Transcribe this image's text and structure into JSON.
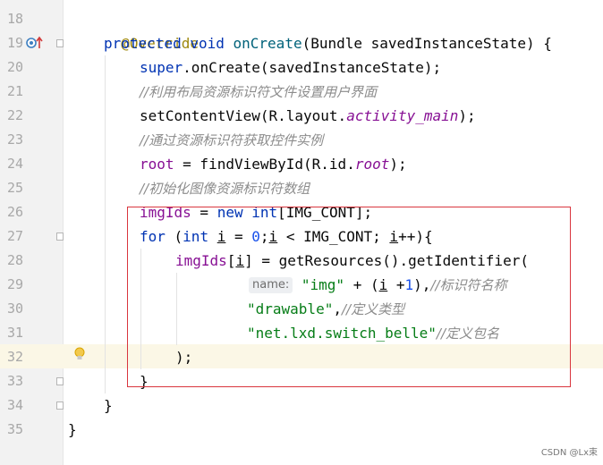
{
  "line_numbers": [
    "18",
    "19",
    "20",
    "21",
    "22",
    "23",
    "24",
    "25",
    "26",
    "27",
    "28",
    "29",
    "30",
    "31",
    "32",
    "33",
    "34",
    "35"
  ],
  "code": {
    "l18": "@Override",
    "l19": [
      "protected",
      "void",
      "onCreate",
      "(Bundle savedInstanceState) {"
    ],
    "l20": [
      "super",
      ".onCreate(savedInstanceState);"
    ],
    "l21": "//利用布局资源标识符文件设置用户界面",
    "l22": [
      "setContentView(R.layout.",
      "activity_main",
      ");"
    ],
    "l23": "//通过资源标识符获取控件实例",
    "l24": [
      "root",
      " = findViewById(R.id.",
      "root",
      ");"
    ],
    "l25": "//初始化图像资源标识符数组",
    "l26": [
      "imgIds",
      " = ",
      "new",
      " ",
      "int",
      "[IMG_CONT];"
    ],
    "l27": [
      "for",
      " (",
      "int",
      " ",
      "i",
      " = ",
      "0",
      ";",
      "i",
      " < IMG_CONT; ",
      "i",
      "++){"
    ],
    "l28": [
      "imgIds",
      "[",
      "i",
      "] = getResources().getIdentifier("
    ],
    "l29": [
      "name:",
      "\"img\"",
      " + (",
      "i",
      " +",
      "1",
      "),",
      "//标识符名称"
    ],
    "l30": [
      "\"drawable\"",
      ",",
      "//定义类型"
    ],
    "l31": [
      "\"net.lxd.switch_belle\"",
      "//定义包名"
    ],
    "l32": ");",
    "l33": "}",
    "l34": "}",
    "l35": "}"
  },
  "watermark": "CSDN @Lx束",
  "colors": {
    "keyword": "#0033b3",
    "function": "#00627a",
    "annotation": "#9e880d",
    "field": "#871094",
    "string": "#067d17",
    "number": "#1750eb",
    "comment": "#8c8c8c",
    "highlight_box": "#d9363e"
  },
  "gutter_icons": [
    "override-method-icon",
    "lightbulb-icon"
  ]
}
